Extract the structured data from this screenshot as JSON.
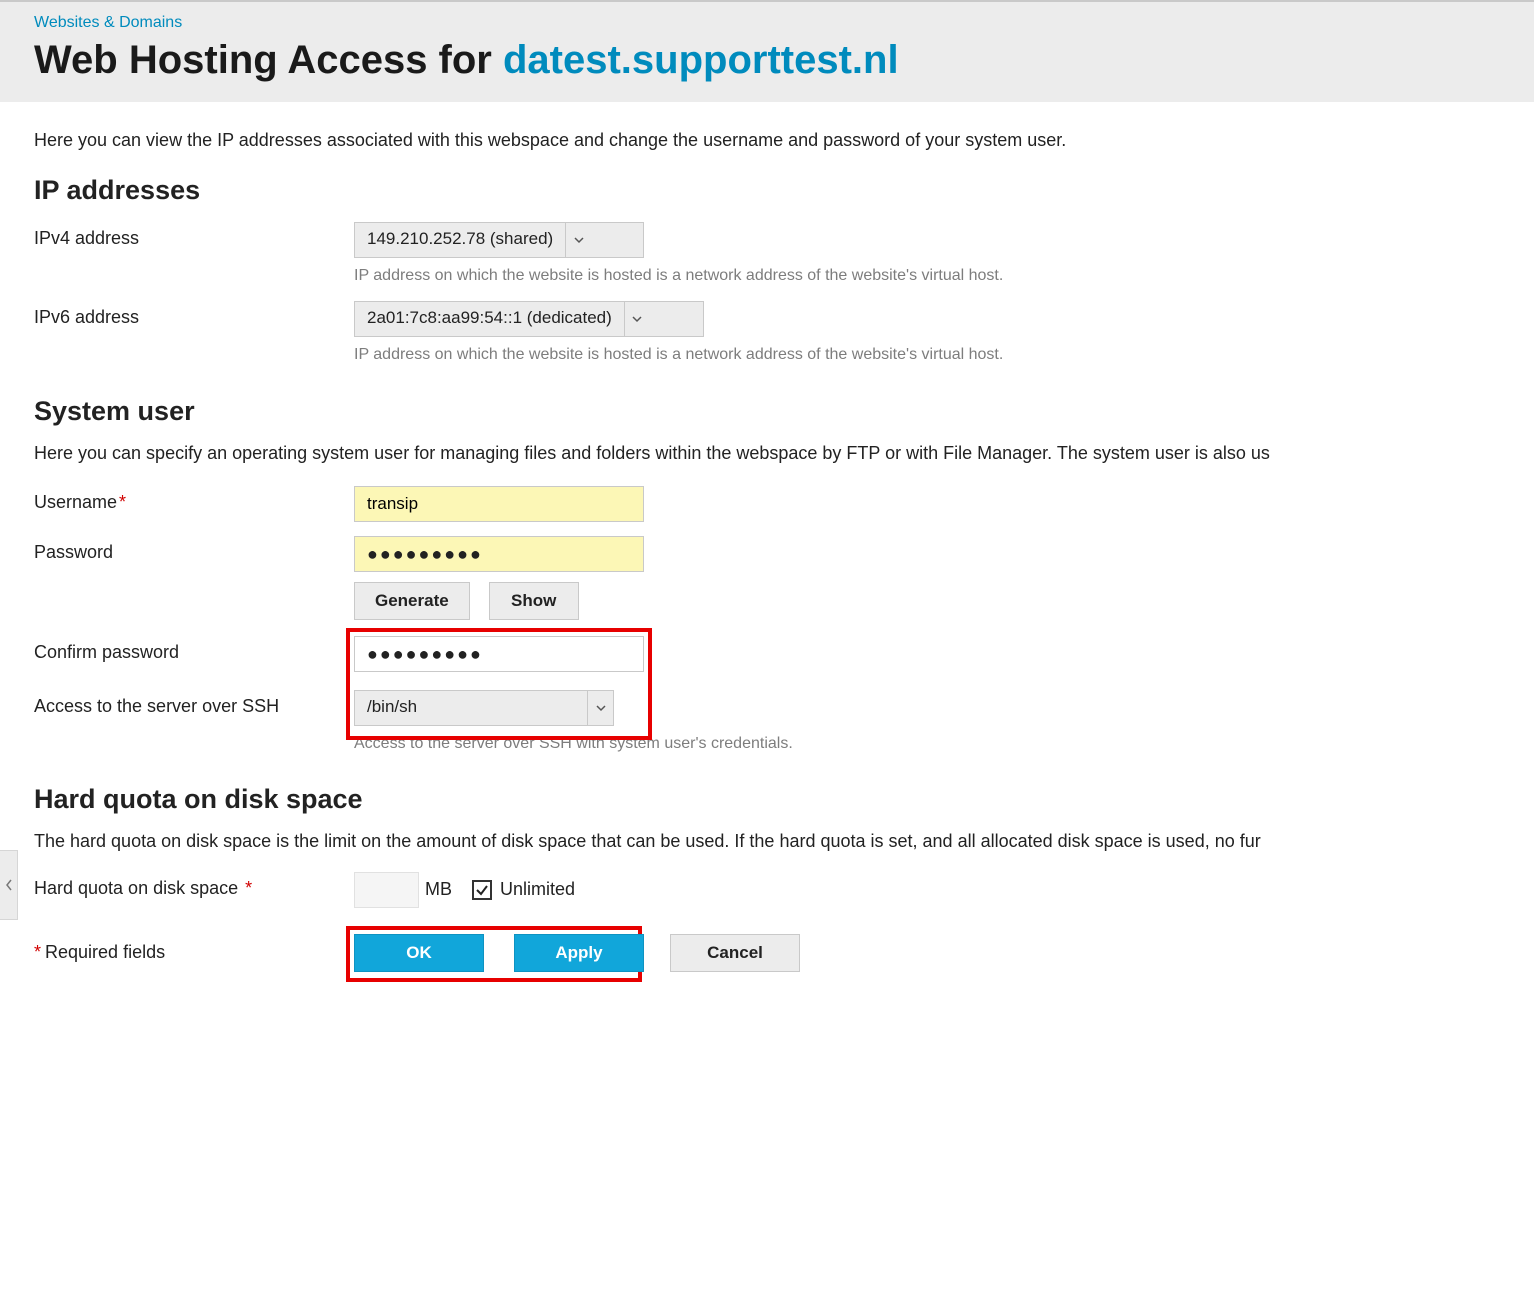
{
  "breadcrumb": {
    "root": "Websites & Domains"
  },
  "title": {
    "prefix": "Web Hosting Access for ",
    "domain": "datest.supporttest.nl"
  },
  "intro": "Here you can view the IP addresses associated with this webspace and change the username and password of your system user.",
  "ip": {
    "heading": "IP addresses",
    "v4_label": "IPv4 address",
    "v4_value": "149.210.252.78 (shared)",
    "v4_hint": "IP address on which the website is hosted is a network address of the website's virtual host.",
    "v6_label": "IPv6 address",
    "v6_value": "2a01:7c8:aa99:54::1 (dedicated)",
    "v6_hint": "IP address on which the website is hosted is a network address of the website's virtual host."
  },
  "sysuser": {
    "heading": "System user",
    "intro": "Here you can specify an operating system user for managing files and folders within the webspace by FTP or with File Manager. The system user is also us",
    "username_label": "Username",
    "username_value": "transip",
    "password_label": "Password",
    "password_mask": "●●●●●●●●●",
    "generate_btn": "Generate",
    "show_btn": "Show",
    "confirm_label": "Confirm password",
    "confirm_mask": "●●●●●●●●●",
    "ssh_label": "Access to the server over SSH",
    "ssh_value": "/bin/sh",
    "ssh_hint": "Access to the server over SSH with system user's credentials."
  },
  "quota": {
    "heading": "Hard quota on disk space",
    "intro": "The hard quota on disk space is the limit on the amount of disk space that can be used. If the hard quota is set, and all allocated disk space is used, no fur",
    "label": "Hard quota on disk space",
    "unit": "MB",
    "unlimited_label": "Unlimited",
    "unlimited_checked": true
  },
  "footer": {
    "required_note": "Required fields",
    "ok": "OK",
    "apply": "Apply",
    "cancel": "Cancel"
  }
}
